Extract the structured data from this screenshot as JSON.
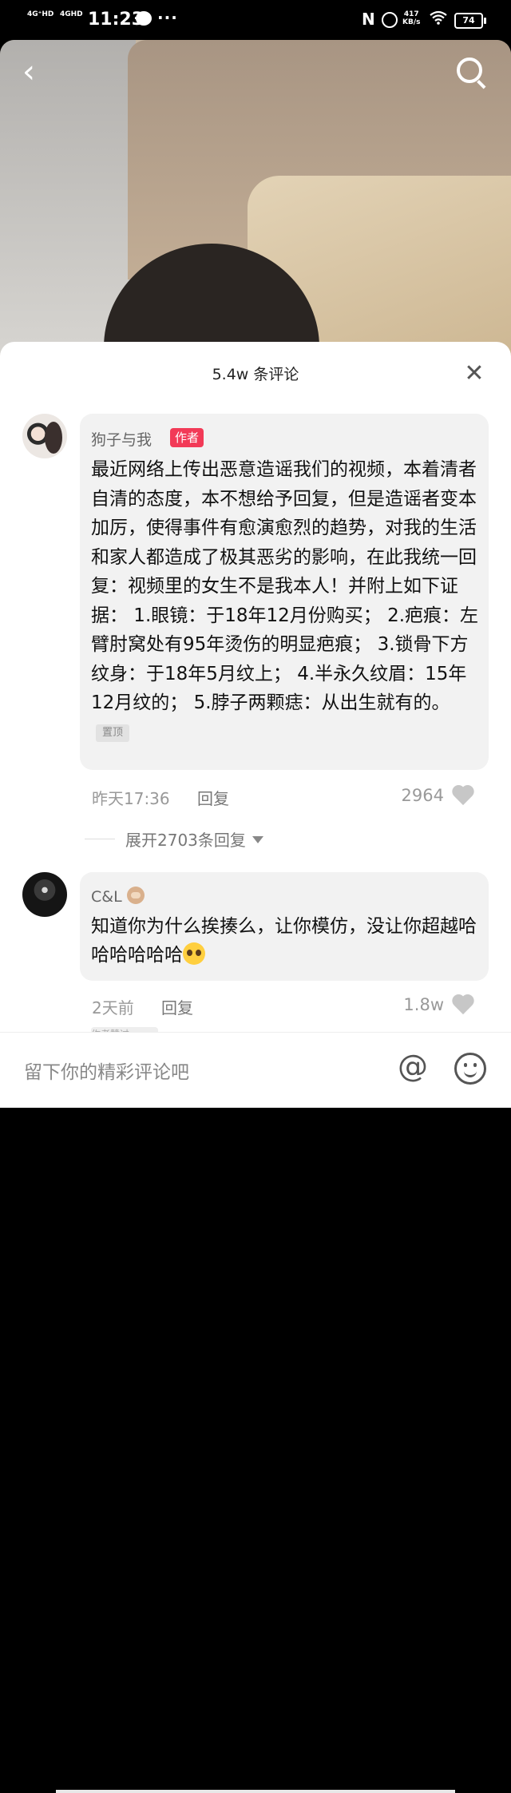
{
  "status_bar": {
    "network1": "4G⁺HD",
    "network2": "4GHD",
    "time": "11:23",
    "dots": "···",
    "nfc": "N",
    "speed_value": "417",
    "speed_unit": "KB/s",
    "battery": "74"
  },
  "nav": {
    "back_glyph": "‹",
    "back_icon": "back-arrow-icon",
    "search_icon": "search-icon"
  },
  "sheet": {
    "title": "5.4w 条评论",
    "close_glyph": "✕"
  },
  "comments": [
    {
      "user": "狗子与我",
      "tag": "作者",
      "text": "最近网络上传出恶意造谣我们的视频，本着清者自清的态度，本不想给予回复，但是造谣者变本加厉，使得事件有愈演愈烈的趋势，对我的生活和家人都造成了极其恶劣的影响，在此我统一回复：视频里的女生不是我本人！并附上如下证据： 1.眼镜：于18年12月份购买； 2.疤痕：左臂肘窝处有95年烫伤的明显疤痕； 3.锁骨下方纹身：于18年5月纹上； 4.半永久纹眉：15年12月纹的； 5.脖子两颗痣：从出生就有的。",
      "pinned_label": "置顶",
      "time": "昨天17:36",
      "reply_label": "回复",
      "likes": "2964",
      "expand_label": "展开2703条回复"
    },
    {
      "user": "C&L",
      "text": "知道你为什么挨揍么，让你模仿，没让你超越哈哈哈哈哈哈",
      "time": "2天前",
      "reply_label": "回复",
      "likes": "1.8w",
      "liked_by_author": "作者赞过"
    }
  ],
  "input": {
    "placeholder": "留下你的精彩评论吧",
    "at_glyph": "@",
    "emoji_icon": "smiley-icon"
  }
}
